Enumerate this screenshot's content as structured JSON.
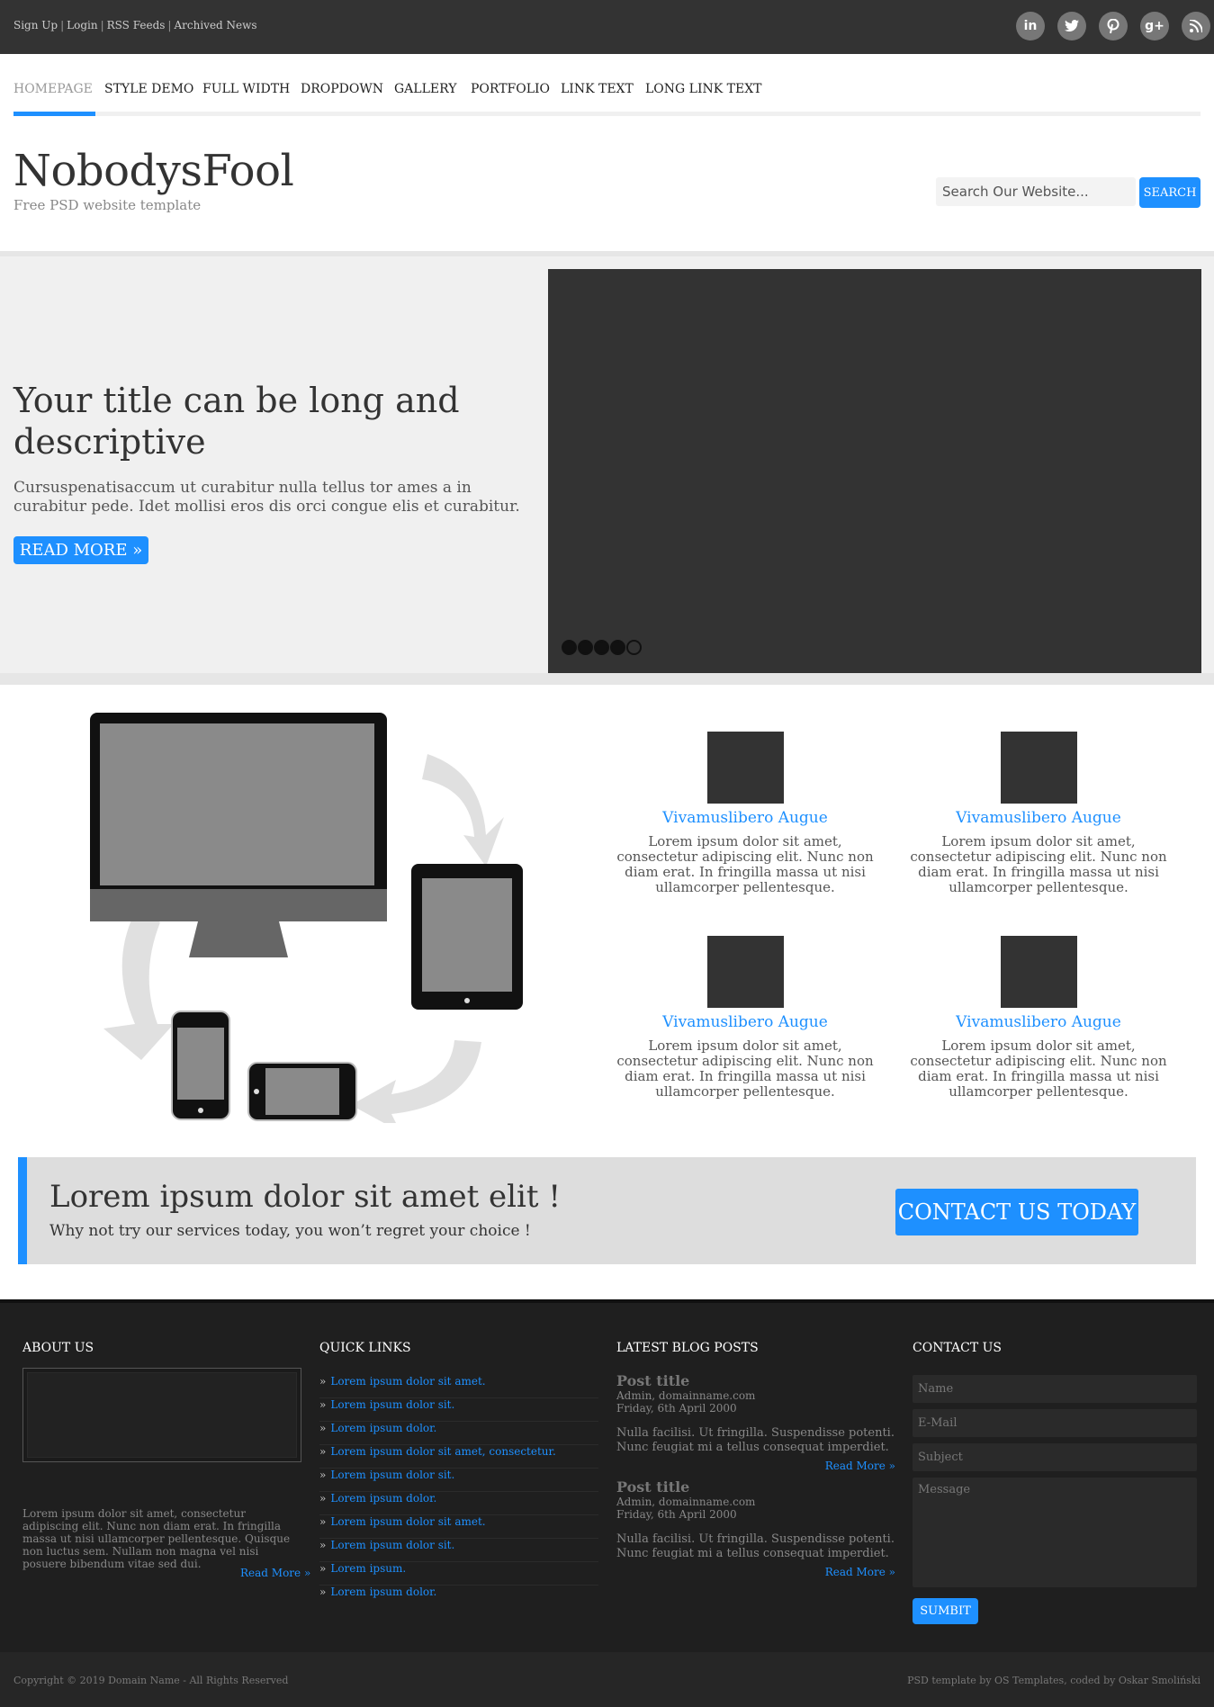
{
  "topbar": {
    "links": [
      "Sign Up",
      "Login",
      "RSS Feeds",
      "Archived News"
    ],
    "social": [
      {
        "icon": "linkedin-icon",
        "glyph": "in"
      },
      {
        "icon": "twitter-icon",
        "glyph": "🐦"
      },
      {
        "icon": "pinterest-icon",
        "glyph": "P"
      },
      {
        "icon": "google-plus-icon",
        "glyph": "g+"
      },
      {
        "icon": "rss-icon",
        "glyph": "◔"
      }
    ]
  },
  "nav": {
    "items": [
      "HOMEPAGE",
      "STYLE DEMO",
      "FULL WIDTH",
      "DROPDOWN",
      "GALLERY",
      "PORTFOLIO",
      "LINK TEXT",
      "LONG LINK TEXT"
    ],
    "active": "HOMEPAGE"
  },
  "header": {
    "title": "NobodysFool",
    "subtitle": "Free PSD website template",
    "search_placeholder": "Search Our Website...",
    "search_button": "SEARCH"
  },
  "hero": {
    "title": "Your title can be long and descriptive",
    "text": "Cursuspenatisaccum ut curabitur nulla tellus tor ames a in curabitur pede. Idet mollisi eros dis orci congue elis et curabitur.",
    "button": "READ MORE »",
    "slides_total": 5,
    "slide_active": 5
  },
  "features": [
    {
      "title": "Vivamuslibero Augue",
      "text": "Lorem ipsum dolor sit amet, consectetur adipiscing elit. Nunc non diam erat. In fringilla massa ut nisi ullamcorper pellentesque."
    },
    {
      "title": "Vivamuslibero Augue",
      "text": "Lorem ipsum dolor sit amet, consectetur adipiscing elit. Nunc non diam erat. In fringilla massa ut nisi ullamcorper pellentesque."
    },
    {
      "title": "Vivamuslibero Augue",
      "text": "Lorem ipsum dolor sit amet, consectetur adipiscing elit. Nunc non diam erat. In fringilla massa ut nisi ullamcorper pellentesque."
    },
    {
      "title": "Vivamuslibero Augue",
      "text": "Lorem ipsum dolor sit amet, consectetur adipiscing elit. Nunc non diam erat. In fringilla massa ut nisi ullamcorper pellentesque."
    }
  ],
  "cta": {
    "title": "Lorem ipsum dolor sit amet elit !",
    "subtitle": "Why not try our services today, you won’t regret your choice !",
    "button": "CONTACT US TODAY"
  },
  "footer": {
    "about": {
      "heading": "ABOUT US",
      "text": "Lorem ipsum dolor sit amet, consectetur adipiscing elit. Nunc non diam erat. In fringilla massa ut nisi ullamcorper pellentesque. Quisque non luctus sem. Nullam non magna vel nisi posuere bibendum vitae sed dui.",
      "more": "Read More »"
    },
    "quick_links": {
      "heading": "QUICK LINKS",
      "links": [
        "Lorem ipsum dolor sit amet.",
        "Lorem ipsum dolor sit.",
        "Lorem ipsum dolor.",
        "Lorem ipsum dolor sit amet, consectetur.",
        "Lorem ipsum dolor sit.",
        "Lorem ipsum dolor.",
        "Lorem ipsum dolor sit amet.",
        "Lorem ipsum dolor sit.",
        "Lorem ipsum.",
        "Lorem ipsum dolor."
      ]
    },
    "blog": {
      "heading": "LATEST BLOG POSTS",
      "posts": [
        {
          "title": "Post title",
          "author": "Admin, domainname.com",
          "date": "Friday, 6th April 2000",
          "text": "Nulla facilisi. Ut fringilla. Suspendisse potenti. Nunc feugiat mi a tellus consequat imperdiet.",
          "more": "Read More »"
        },
        {
          "title": "Post title",
          "author": "Admin, domainname.com",
          "date": "Friday, 6th April 2000",
          "text": "Nulla facilisi. Ut fringilla. Suspendisse potenti. Nunc feugiat mi a tellus consequat imperdiet.",
          "more": "Read More »"
        }
      ]
    },
    "contact": {
      "heading": "CONTACT US",
      "name_placeholder": "Name",
      "email_placeholder": "E-Mail",
      "subject_placeholder": "Subject",
      "message_placeholder": "Message",
      "submit": "SUMBIT"
    },
    "copyright": "Copyright © 2019 Domain Name - All Rights Reserved",
    "credit": "PSD template by OS Templates, coded by Oskar Smoliński"
  },
  "colors": {
    "accent": "#1e90ff",
    "topbar": "#333333",
    "footer": "#1f1f1f"
  }
}
